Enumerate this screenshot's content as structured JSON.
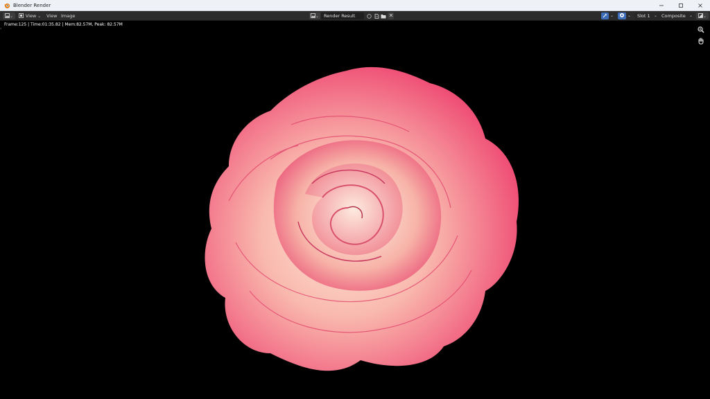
{
  "window": {
    "title": "Blender Render",
    "minimize_icon": "minimize-icon",
    "maximize_icon": "maximize-icon",
    "close_icon": "close-icon"
  },
  "header": {
    "editor_type_icon": "image-editor-icon",
    "mode_icon": "view-mode-icon",
    "mode_label": "View",
    "menus": [
      "View",
      "Image"
    ],
    "image_browse_icon": "image-browse-icon",
    "image_name": "Render Result",
    "slot_label": "Slot 1",
    "layer_label": "Composite"
  },
  "viewport": {
    "stats": "Frame:125 | Time:01:35.82 | Mem:82.57M, Peak: 82.57M",
    "zoom_icon": "zoom-icon",
    "pan_icon": "hand-pan-icon",
    "subject": "pink-rose"
  },
  "colors": {
    "title_bar": "#eef2f7",
    "header_bg": "#2c2c2c",
    "accent_blue": "#3e6dba",
    "viewport_bg": "#000000",
    "rose_edge": "#ef3f6c",
    "rose_center": "#fde5d4"
  }
}
